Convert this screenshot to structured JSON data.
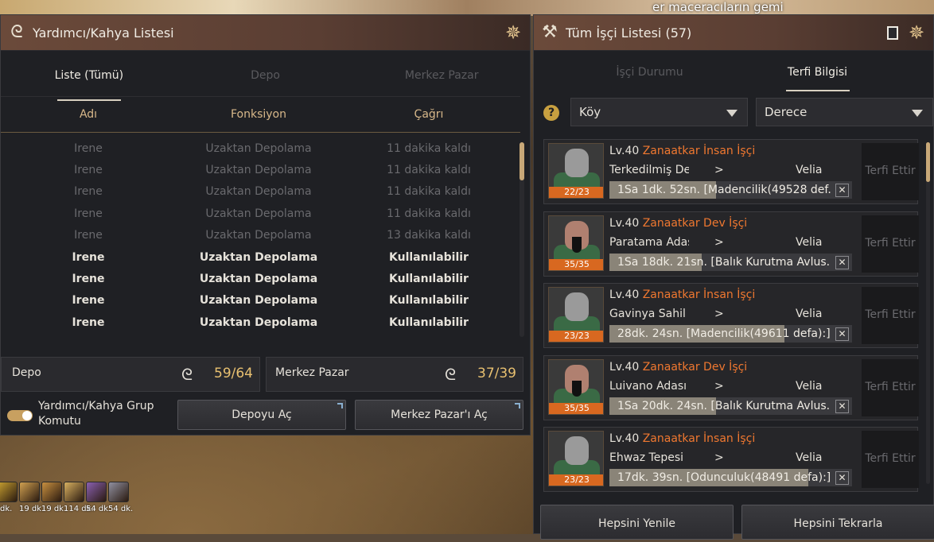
{
  "background": {
    "overlay_text": "er maceracıların gemi"
  },
  "left_panel": {
    "title": "Yardımcı/Kahya Listesi",
    "tabs": [
      {
        "label": "Liste (Tümü)",
        "active": true
      },
      {
        "label": "Depo",
        "active": false
      },
      {
        "label": "Merkez Pazar",
        "active": false
      }
    ],
    "columns": [
      "Adı",
      "Fonksiyon",
      "Çağrı"
    ],
    "rows": [
      {
        "name": "Irene",
        "function": "Uzaktan Depolama",
        "call": "11 dakika kaldı",
        "available": false
      },
      {
        "name": "Irene",
        "function": "Uzaktan Depolama",
        "call": "11 dakika kaldı",
        "available": false
      },
      {
        "name": "Irene",
        "function": "Uzaktan Depolama",
        "call": "11 dakika kaldı",
        "available": false
      },
      {
        "name": "Irene",
        "function": "Uzaktan Depolama",
        "call": "11 dakika kaldı",
        "available": false
      },
      {
        "name": "Irene",
        "function": "Uzaktan Depolama",
        "call": "13 dakika kaldı",
        "available": false
      },
      {
        "name": "Irene",
        "function": "Uzaktan Depolama",
        "call": "Kullanılabilir",
        "available": true
      },
      {
        "name": "Irene",
        "function": "Uzaktan Depolama",
        "call": "Kullanılabilir",
        "available": true
      },
      {
        "name": "Irene",
        "function": "Uzaktan Depolama",
        "call": "Kullanılabilir",
        "available": true
      },
      {
        "name": "Irene",
        "function": "Uzaktan Depolama",
        "call": "Kullanılabilir",
        "available": true
      }
    ],
    "depo": {
      "label": "Depo",
      "count": "59/64"
    },
    "market": {
      "label": "Merkez Pazar",
      "count": "37/39"
    },
    "group_command": {
      "line1": "Yardımcı/Kahya Grup",
      "line2": "Komutu",
      "enabled": true
    },
    "open_storage_button": "Depoyu Aç",
    "open_market_button": "Merkez Pazar'ı Aç"
  },
  "right_panel": {
    "title": "Tüm İşçi Listesi (57)",
    "tabs": [
      {
        "label": "İşçi Durumu",
        "active": false
      },
      {
        "label": "Terfi Bilgisi",
        "active": true
      }
    ],
    "filter_town": "Köy",
    "filter_grade": "Derece",
    "help_icon": "?",
    "workers": [
      {
        "level": "Lv.40",
        "type": "Zanaatkar İnsan İşçi",
        "location": "Terkedilmiş De...",
        "arrow": ">",
        "town": "Velia",
        "task": "1Sa 1dk. 52sn. [Madencilik(49528 def...",
        "progress": 0.44,
        "stamina": "22/23",
        "race": "human",
        "promote": "Terfi Ettir"
      },
      {
        "level": "Lv.40",
        "type": "Zanaatkar Dev İşçi",
        "location": "Paratama Adası",
        "arrow": ">",
        "town": "Velia",
        "task": "1Sa 18dk. 21sn. [Balık Kurutma Avlus...",
        "progress": 0.38,
        "stamina": "35/35",
        "race": "giant",
        "promote": "Terfi Ettir"
      },
      {
        "level": "Lv.40",
        "type": "Zanaatkar İnsan İşçi",
        "location": "Gavinya Sahil Kı...",
        "arrow": ">",
        "town": "Velia",
        "task": "28dk. 24sn. [Madencilik(49611 defa):]",
        "progress": 0.72,
        "stamina": "23/23",
        "race": "human",
        "promote": "Terfi Ettir"
      },
      {
        "level": "Lv.40",
        "type": "Zanaatkar Dev İşçi",
        "location": "Luivano Adası",
        "arrow": ">",
        "town": "Velia",
        "task": "1Sa 20dk. 24sn. [Balık Kurutma Avlus...",
        "progress": 0.44,
        "stamina": "35/35",
        "race": "giant",
        "promote": "Terfi Ettir"
      },
      {
        "level": "Lv.40",
        "type": "Zanaatkar İnsan İşçi",
        "location": "Ehwaz Tepesi",
        "arrow": ">",
        "town": "Velia",
        "task": "17dk. 39sn. [Odunculuk(48491 defa):]",
        "progress": 0.82,
        "stamina": "23/23",
        "race": "human",
        "promote": "Terfi Ettir"
      }
    ],
    "refresh_all_button": "Hepsini Yenile",
    "repeat_all_button": "Hepsini Tekrarla"
  },
  "skillbar": {
    "timers": [
      "dk.",
      "19 dk.",
      "19 dk.",
      "114 dk.",
      "54 dk.",
      "54 dk."
    ],
    "colors": [
      "#c8a030",
      "#d0a050",
      "#c89040",
      "#d8b060",
      "#8a60b0",
      "#9090a0"
    ]
  }
}
